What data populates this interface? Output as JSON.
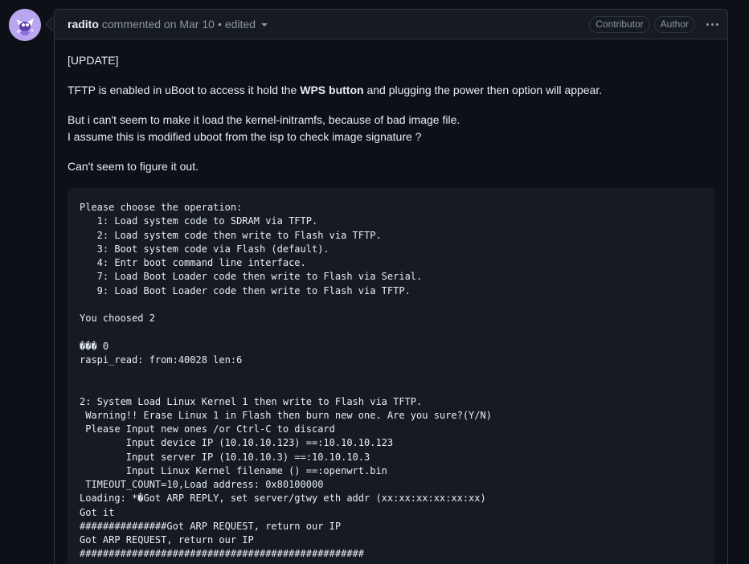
{
  "comment": {
    "author": "radito",
    "action": "commented on",
    "date": "Mar 10",
    "separator": "•",
    "edited_label": "edited",
    "badges": [
      "Contributor",
      "Author"
    ],
    "body": {
      "update": "[UPDATE]",
      "para1_pre": "TFTP is enabled in uBoot to access it hold the ",
      "para1_bold": "WPS button",
      "para1_post": " and plugging the power then option will appear.",
      "para2_line1": "But i can't seem to make it load the kernel-initramfs, because of bad image file.",
      "para2_line2": "I assume this is modified uboot from the isp to check image signature ?",
      "para3": "Can't seem to figure it out."
    },
    "code_lines": [
      "Please choose the operation:",
      "   1: Load system code to SDRAM via TFTP.",
      "   2: Load system code then write to Flash via TFTP.",
      "   3: Boot system code via Flash (default).",
      "   4: Entr boot command line interface.",
      "   7: Load Boot Loader code then write to Flash via Serial.",
      "   9: Load Boot Loader code then write to Flash via TFTP.",
      "",
      "You choosed 2",
      "",
      "��� 0",
      "raspi_read: from:40028 len:6",
      "",
      "",
      "2: System Load Linux Kernel 1 then write to Flash via TFTP.",
      " Warning!! Erase Linux 1 in Flash then burn new one. Are you sure?(Y/N)",
      " Please Input new ones /or Ctrl-C to discard",
      "        Input device IP (10.10.10.123) ==:10.10.10.123",
      "        Input server IP (10.10.10.3) ==:10.10.10.3",
      "        Input Linux Kernel filename () ==:openwrt.bin",
      " TIMEOUT_COUNT=10,Load address: 0x80100000",
      "Loading: *�Got ARP REPLY, set server/gtwy eth addr (xx:xx:xx:xx:xx:xx)",
      "Got it",
      "###############Got ARP REQUEST, return our IP",
      "Got ARP REQUEST, return our IP",
      "#################################################",
      "         #################################################"
    ]
  }
}
